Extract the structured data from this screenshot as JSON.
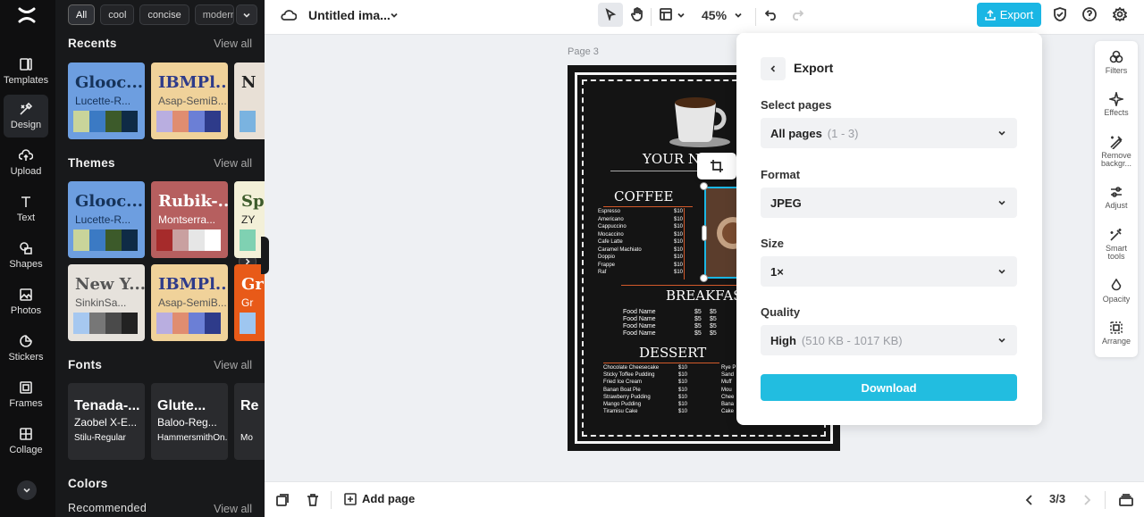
{
  "rail": {
    "items": [
      {
        "label": "Templates",
        "icon": "templates-icon"
      },
      {
        "label": "Design",
        "icon": "design-icon"
      },
      {
        "label": "Upload",
        "icon": "upload-icon"
      },
      {
        "label": "Text",
        "icon": "text-icon"
      },
      {
        "label": "Shapes",
        "icon": "shapes-icon"
      },
      {
        "label": "Photos",
        "icon": "photos-icon"
      },
      {
        "label": "Stickers",
        "icon": "stickers-icon"
      },
      {
        "label": "Frames",
        "icon": "frames-icon"
      },
      {
        "label": "Collage",
        "icon": "collage-icon"
      }
    ]
  },
  "panel": {
    "chips": [
      "All",
      "cool",
      "concise",
      "modern"
    ],
    "recents": {
      "title": "Recents",
      "view_all": "View all",
      "cards": [
        {
          "t1": "Glooc...",
          "t2": "Lucette-R...",
          "swatches": [
            "#c9d49a",
            "#3b7ac4",
            "#3c5a2a",
            "#0f2b46"
          ],
          "bg": "#6d9ee0",
          "c1": "#16335a",
          "c2": "#16335a"
        },
        {
          "t1": "IBMPl...",
          "t2": "Asap-SemiB...",
          "swatches": [
            "#b9aee0",
            "#e08d70",
            "#6b7fd6",
            "#2e3b8a"
          ],
          "bg": "#f0d29a",
          "c1": "#2e3b8a",
          "c2": "#555"
        },
        {
          "t1": "N",
          "t2": "",
          "swatches": [
            "#7ab3e0"
          ],
          "bg": "#e8e0d6",
          "c1": "#222",
          "c2": "#222"
        }
      ]
    },
    "themes": {
      "title": "Themes",
      "view_all": "View all",
      "cards": [
        {
          "t1": "Glooc...",
          "t2": "Lucette-R...",
          "swatches": [
            "#c9d49a",
            "#3b7ac4",
            "#3c5a2a",
            "#0f2b46"
          ],
          "bg": "#6d9ee0",
          "c1": "#16335a",
          "c2": "#16335a"
        },
        {
          "t1": "Rubik-...",
          "t2": "Montserra...",
          "swatches": [
            "#a62b2b",
            "#c9a0a0",
            "#e6e6e6",
            "#ffffff"
          ],
          "bg": "#b65f5f",
          "c1": "#ffffff",
          "c2": "#ffffff"
        },
        {
          "t1": "Sp",
          "t2": "ZY",
          "swatches": [
            "#7fd1b2"
          ],
          "bg": "#f3f0d8",
          "c1": "#3c5a2a",
          "c2": "#222"
        },
        {
          "t1": "New Y...",
          "t2": "SinkinSa...",
          "swatches": [
            "#a6c8f0",
            "#777777",
            "#4a4a4a",
            "#222222"
          ],
          "bg": "#e6e2dc",
          "c1": "#555",
          "c2": "#555"
        },
        {
          "t1": "IBMPl...",
          "t2": "Asap-SemiB...",
          "swatches": [
            "#b9aee0",
            "#e08d70",
            "#6b7fd6",
            "#2e3b8a"
          ],
          "bg": "#f0d29a",
          "c1": "#2e3b8a",
          "c2": "#555"
        },
        {
          "t1": "Gr",
          "t2": "Gr",
          "swatches": [
            "#9ec6f0"
          ],
          "bg": "#e85a18",
          "c1": "#ffffff",
          "c2": "#ffffff"
        }
      ]
    },
    "fonts": {
      "title": "Fonts",
      "view_all": "View all",
      "cards": [
        {
          "a": "Tenada-...",
          "b": "Zaobel X-E...",
          "c": "Stilu-Regular"
        },
        {
          "a": "Glute...",
          "b": "Baloo-Reg...",
          "c": "HammersmithOn..."
        },
        {
          "a": "Re",
          "b": "",
          "c": "Mo"
        }
      ]
    },
    "colors": {
      "title": "Colors",
      "recommended": "Recommended",
      "view_all": "View all"
    }
  },
  "topbar": {
    "doc_title": "Untitled ima...",
    "zoom": "45%",
    "export_label": "Export"
  },
  "canvas": {
    "page_label": "Page 3",
    "menu": {
      "your_name": "YOUR N",
      "coffee": "COFFEE",
      "coffee_items": [
        "Espresso",
        "Americano",
        "Cappuccino",
        "Mocaccino",
        "Cafe Latte",
        "Caramel Machiato",
        "Doppio",
        "Frappe",
        "Raf"
      ],
      "price": "$10",
      "breakfast": "BREAKFAS",
      "breakfast_items": [
        "Food Name",
        "Food Name",
        "Food Name",
        "Food Name"
      ],
      "bprice": "$5",
      "dessert": "DESSERT",
      "dessert_items": [
        "Chocolate Cheesecake",
        "Sticky Toffee Pudding",
        "Fried Ice Cream",
        "Banan Boat Pie",
        "Strawberry Pudding",
        "Mango Pudding",
        "Tiramisu Cake"
      ],
      "right_items": [
        "Rye P",
        "Sand",
        "Muff",
        "Mou",
        "Chee",
        "Bana",
        "Cake"
      ]
    }
  },
  "export_modal": {
    "title": "Export",
    "select_pages_label": "Select pages",
    "select_pages_value": "All pages",
    "select_pages_hint": "(1 - 3)",
    "format_label": "Format",
    "format_value": "JPEG",
    "size_label": "Size",
    "size_value": "1×",
    "quality_label": "Quality",
    "quality_value": "High",
    "quality_hint": "(510 KB - 1017 KB)",
    "download_label": "Download"
  },
  "right_tools": [
    {
      "label": "Filters",
      "icon": "filters-icon"
    },
    {
      "label": "Effects",
      "icon": "effects-icon"
    },
    {
      "label": "Remove backgr...",
      "icon": "remove-background-icon"
    },
    {
      "label": "Adjust",
      "icon": "adjust-icon"
    },
    {
      "label": "Smart tools",
      "icon": "smart-tools-icon"
    },
    {
      "label": "Opacity",
      "icon": "opacity-icon"
    },
    {
      "label": "Arrange",
      "icon": "arrange-icon"
    }
  ],
  "bottombar": {
    "add_page": "Add page",
    "page_count": "3/3"
  }
}
